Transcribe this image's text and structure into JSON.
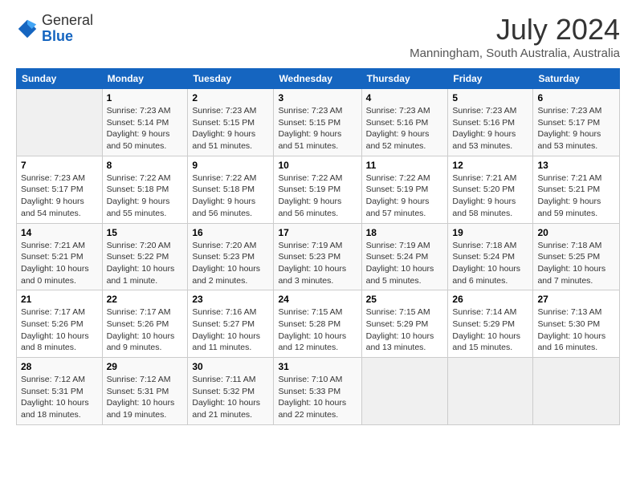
{
  "header": {
    "logo_general": "General",
    "logo_blue": "Blue",
    "month_year": "July 2024",
    "location": "Manningham, South Australia, Australia"
  },
  "calendar": {
    "days_of_week": [
      "Sunday",
      "Monday",
      "Tuesday",
      "Wednesday",
      "Thursday",
      "Friday",
      "Saturday"
    ],
    "weeks": [
      [
        {
          "day": "",
          "content": ""
        },
        {
          "day": "1",
          "content": "Sunrise: 7:23 AM\nSunset: 5:14 PM\nDaylight: 9 hours\nand 50 minutes."
        },
        {
          "day": "2",
          "content": "Sunrise: 7:23 AM\nSunset: 5:15 PM\nDaylight: 9 hours\nand 51 minutes."
        },
        {
          "day": "3",
          "content": "Sunrise: 7:23 AM\nSunset: 5:15 PM\nDaylight: 9 hours\nand 51 minutes."
        },
        {
          "day": "4",
          "content": "Sunrise: 7:23 AM\nSunset: 5:16 PM\nDaylight: 9 hours\nand 52 minutes."
        },
        {
          "day": "5",
          "content": "Sunrise: 7:23 AM\nSunset: 5:16 PM\nDaylight: 9 hours\nand 53 minutes."
        },
        {
          "day": "6",
          "content": "Sunrise: 7:23 AM\nSunset: 5:17 PM\nDaylight: 9 hours\nand 53 minutes."
        }
      ],
      [
        {
          "day": "7",
          "content": "Sunrise: 7:23 AM\nSunset: 5:17 PM\nDaylight: 9 hours\nand 54 minutes."
        },
        {
          "day": "8",
          "content": "Sunrise: 7:22 AM\nSunset: 5:18 PM\nDaylight: 9 hours\nand 55 minutes."
        },
        {
          "day": "9",
          "content": "Sunrise: 7:22 AM\nSunset: 5:18 PM\nDaylight: 9 hours\nand 56 minutes."
        },
        {
          "day": "10",
          "content": "Sunrise: 7:22 AM\nSunset: 5:19 PM\nDaylight: 9 hours\nand 56 minutes."
        },
        {
          "day": "11",
          "content": "Sunrise: 7:22 AM\nSunset: 5:19 PM\nDaylight: 9 hours\nand 57 minutes."
        },
        {
          "day": "12",
          "content": "Sunrise: 7:21 AM\nSunset: 5:20 PM\nDaylight: 9 hours\nand 58 minutes."
        },
        {
          "day": "13",
          "content": "Sunrise: 7:21 AM\nSunset: 5:21 PM\nDaylight: 9 hours\nand 59 minutes."
        }
      ],
      [
        {
          "day": "14",
          "content": "Sunrise: 7:21 AM\nSunset: 5:21 PM\nDaylight: 10 hours\nand 0 minutes."
        },
        {
          "day": "15",
          "content": "Sunrise: 7:20 AM\nSunset: 5:22 PM\nDaylight: 10 hours\nand 1 minute."
        },
        {
          "day": "16",
          "content": "Sunrise: 7:20 AM\nSunset: 5:23 PM\nDaylight: 10 hours\nand 2 minutes."
        },
        {
          "day": "17",
          "content": "Sunrise: 7:19 AM\nSunset: 5:23 PM\nDaylight: 10 hours\nand 3 minutes."
        },
        {
          "day": "18",
          "content": "Sunrise: 7:19 AM\nSunset: 5:24 PM\nDaylight: 10 hours\nand 5 minutes."
        },
        {
          "day": "19",
          "content": "Sunrise: 7:18 AM\nSunset: 5:24 PM\nDaylight: 10 hours\nand 6 minutes."
        },
        {
          "day": "20",
          "content": "Sunrise: 7:18 AM\nSunset: 5:25 PM\nDaylight: 10 hours\nand 7 minutes."
        }
      ],
      [
        {
          "day": "21",
          "content": "Sunrise: 7:17 AM\nSunset: 5:26 PM\nDaylight: 10 hours\nand 8 minutes."
        },
        {
          "day": "22",
          "content": "Sunrise: 7:17 AM\nSunset: 5:26 PM\nDaylight: 10 hours\nand 9 minutes."
        },
        {
          "day": "23",
          "content": "Sunrise: 7:16 AM\nSunset: 5:27 PM\nDaylight: 10 hours\nand 11 minutes."
        },
        {
          "day": "24",
          "content": "Sunrise: 7:15 AM\nSunset: 5:28 PM\nDaylight: 10 hours\nand 12 minutes."
        },
        {
          "day": "25",
          "content": "Sunrise: 7:15 AM\nSunset: 5:29 PM\nDaylight: 10 hours\nand 13 minutes."
        },
        {
          "day": "26",
          "content": "Sunrise: 7:14 AM\nSunset: 5:29 PM\nDaylight: 10 hours\nand 15 minutes."
        },
        {
          "day": "27",
          "content": "Sunrise: 7:13 AM\nSunset: 5:30 PM\nDaylight: 10 hours\nand 16 minutes."
        }
      ],
      [
        {
          "day": "28",
          "content": "Sunrise: 7:12 AM\nSunset: 5:31 PM\nDaylight: 10 hours\nand 18 minutes."
        },
        {
          "day": "29",
          "content": "Sunrise: 7:12 AM\nSunset: 5:31 PM\nDaylight: 10 hours\nand 19 minutes."
        },
        {
          "day": "30",
          "content": "Sunrise: 7:11 AM\nSunset: 5:32 PM\nDaylight: 10 hours\nand 21 minutes."
        },
        {
          "day": "31",
          "content": "Sunrise: 7:10 AM\nSunset: 5:33 PM\nDaylight: 10 hours\nand 22 minutes."
        },
        {
          "day": "",
          "content": ""
        },
        {
          "day": "",
          "content": ""
        },
        {
          "day": "",
          "content": ""
        }
      ]
    ]
  }
}
